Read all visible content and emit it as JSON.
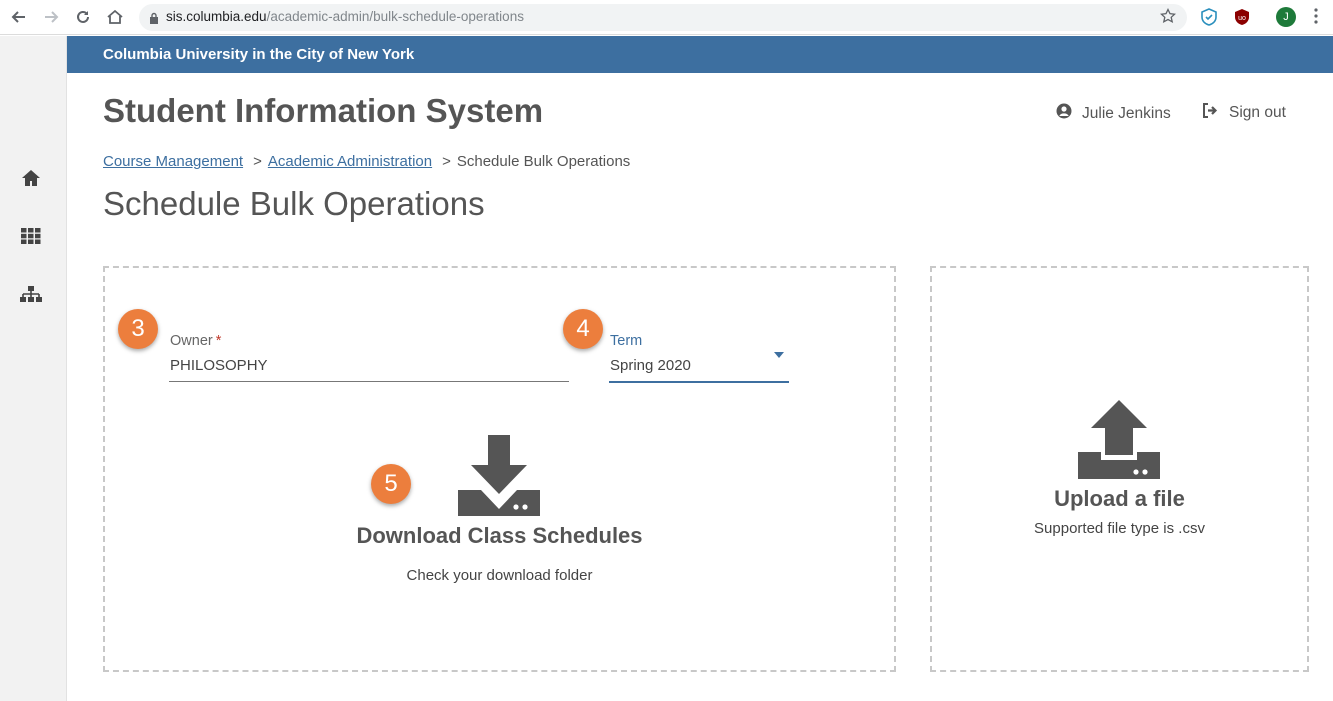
{
  "browser": {
    "url_domain": "sis.columbia.edu",
    "url_path": "/academic-admin/bulk-schedule-operations",
    "profile_initial": "J"
  },
  "header": {
    "university": "Columbia University in the City of New York",
    "app_title": "Student Information System",
    "user_name": "Julie Jenkins",
    "signout_label": "Sign out",
    "band_color": "#3d6fa0"
  },
  "sidebar": {
    "icons": [
      "home-icon",
      "apps-grid-icon",
      "sitemap-icon"
    ]
  },
  "breadcrumb": {
    "items": [
      {
        "label": "Course Management"
      },
      {
        "label": "Academic Administration"
      },
      {
        "label": "Schedule Bulk Operations"
      }
    ],
    "separator": ">"
  },
  "page": {
    "title": "Schedule Bulk Operations"
  },
  "form": {
    "owner": {
      "label": "Owner",
      "required_mark": "*",
      "value": "PHILOSOPHY"
    },
    "term": {
      "label": "Term",
      "value": "Spring 2020"
    }
  },
  "download": {
    "title": "Download Class Schedules",
    "subtitle": "Check your download folder"
  },
  "upload": {
    "title": "Upload a file",
    "subtitle": "Supported file type is .csv"
  },
  "steps": {
    "owner": "3",
    "term": "4",
    "download": "5"
  },
  "colors": {
    "accent": "#3d6fa0",
    "step_badge": "#ec7e3d"
  }
}
